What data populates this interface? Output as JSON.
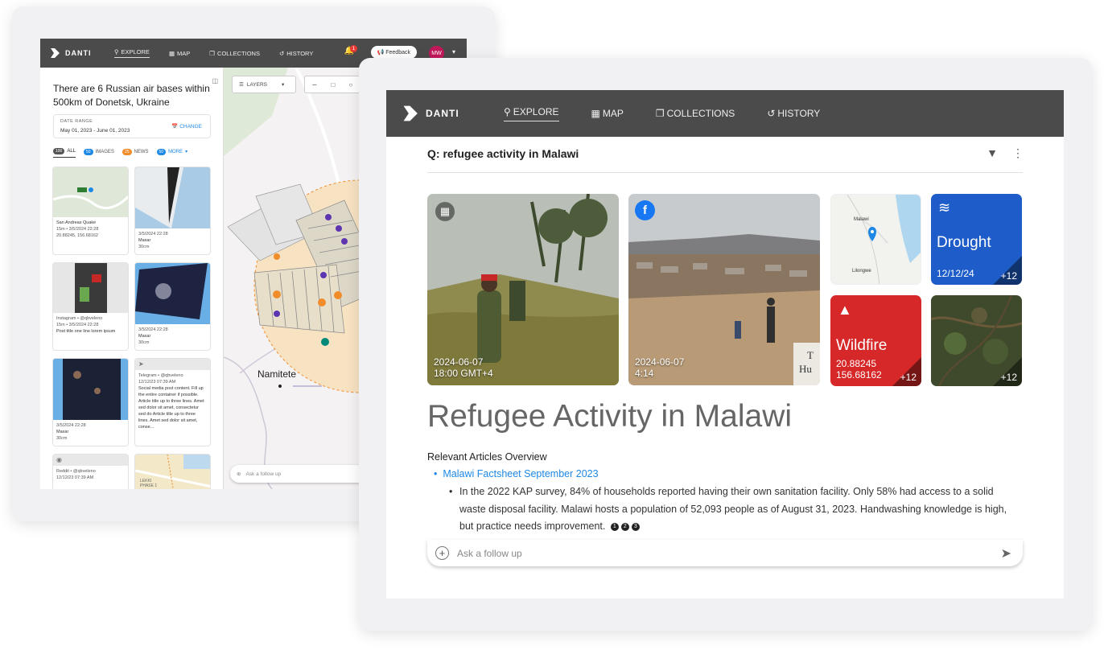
{
  "app": {
    "name": "DANTI"
  },
  "colors": {
    "topbar": "#4b4b4b",
    "accent": "#1e88e5",
    "drought": "#1e5dc9",
    "wildfire": "#d62828",
    "avatar": "#c2185b"
  },
  "nav": {
    "explore": "EXPLORE",
    "map": "MAP",
    "collections": "COLLECTIONS",
    "history": "HISTORY"
  },
  "back": {
    "notifications_count": "1",
    "feedback_label": "Feedback",
    "avatar_initials": "MW",
    "query": "There are 6 Russian air bases within 500km of Donetsk, Ukraine",
    "date_range": {
      "label": "DATE RANGE",
      "value": "May 01, 2023 - June 01, 2023",
      "change_label": "CHANGE"
    },
    "filters": [
      {
        "count": "100",
        "label": "ALL",
        "color": "#555555"
      },
      {
        "count": "50",
        "label": "IMAGES",
        "color": "#1e88e5"
      },
      {
        "count": "25",
        "label": "NEWS",
        "color": "#f08c2a"
      },
      {
        "count": "50",
        "label": "MORE",
        "color": "#1e88e5"
      }
    ],
    "cards": [
      {
        "source": "San Andreas Quake",
        "line2": "15m • 3/5/2024 22:28",
        "line3": "20.88245, 156.68162"
      },
      {
        "source": "3/5/2024 22:28",
        "line2": "Maxar",
        "line3": "30cm"
      },
      {
        "source": "Instagram • @qbveleno",
        "line2": "15m • 3/5/2024 22:28",
        "line3": "Post title one line lorem ipsum"
      },
      {
        "source": "3/5/2024 22:28",
        "line2": "Maxar",
        "line3": "30cm"
      },
      {
        "source": "3/5/2024 22:28",
        "line2": "Maxar",
        "line3": "30cm"
      },
      {
        "source": "Telegram • @qbveleno",
        "line2": "12/12/23 07:39 AM",
        "line3": "Social media post content. Fill up the entire container if possible. Article title up to three lines. Amet sed dolor sit amet, consectetur sed do Article title up to three lines. Amet sed dolor sit amet, conse..."
      },
      {
        "source": "Reddit • @qbveleno",
        "line2": "12/12/23 07:39 AM",
        "line3": ""
      }
    ],
    "map": {
      "layers_label": "LAYERS",
      "place_label": "Namitete",
      "ask_placeholder": "Ask a follow up",
      "map_text": "LEKKI PHASE 1"
    }
  },
  "front": {
    "query": "Q: refugee activity in Malawi",
    "tiles": [
      {
        "kind": "photo",
        "date": "2024-06-07",
        "time": "18:00 GMT+4",
        "icon": "news-icon"
      },
      {
        "kind": "photo",
        "date": "2024-06-07",
        "time": "4:14",
        "icon": "facebook-icon"
      },
      {
        "kind": "map",
        "labels": [
          "Malawi",
          "Lilongwe"
        ]
      },
      {
        "kind": "event",
        "title": "Drought",
        "date": "12/12/24",
        "more": "+12",
        "icon": "heat-icon"
      },
      {
        "kind": "event",
        "title": "Wildfire",
        "lat": "20.88245",
        "lon": "156.68162",
        "more": "+12",
        "icon": "fire-icon"
      },
      {
        "kind": "satellite",
        "more": "+12"
      }
    ],
    "title": "Refugee Activity in Malawi",
    "section_label": "Relevant Articles Overview",
    "article_title": "Malawi Factsheet September 2023",
    "article_summary": "In the 2022 KAP survey, 84% of households reported having their own sanitation facility. Only 58% had access to a solid waste disposal facility. Malawi hosts a population of 52,093 people as of August 31, 2023. Handwashing knowledge is high, but practice needs improvement.",
    "citations": [
      "1",
      "2",
      "3"
    ],
    "ask_placeholder": "Ask a follow up"
  }
}
